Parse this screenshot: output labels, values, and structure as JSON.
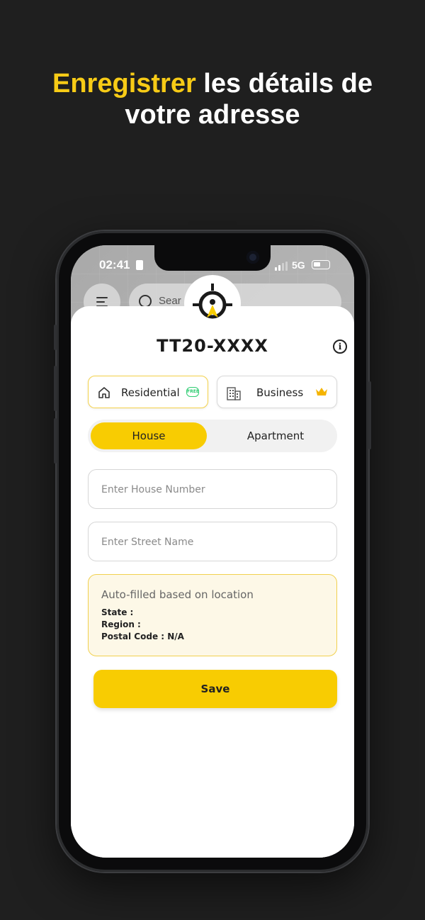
{
  "headline": {
    "accent": "Enregistrer",
    "rest_line1": " les détails de",
    "line2": "votre adresse"
  },
  "status_bar": {
    "time": "02:41",
    "network": "5G"
  },
  "map": {
    "search_placeholder": "Sear"
  },
  "sheet": {
    "plate": "TT20-XXXX",
    "info_icon": "i",
    "address_types": [
      {
        "label": "Residential",
        "badge": "FREE",
        "icon": "house-icon",
        "selected": true
      },
      {
        "label": "Business",
        "badge_icon": "crown-icon",
        "icon": "building-icon",
        "selected": false
      }
    ],
    "segments": [
      {
        "label": "House",
        "selected": true
      },
      {
        "label": "Apartment",
        "selected": false
      }
    ],
    "house_number_placeholder": "Enter House Number",
    "street_name_placeholder": "Enter Street Name",
    "auto_filled": {
      "title": "Auto-filled based on location",
      "state": "State :",
      "region": "Region :",
      "postal_code": "Postal Code : N/A"
    },
    "save_label": "Save"
  },
  "colors": {
    "accent": "#f8cc02",
    "headline_accent": "#f7cb16",
    "free_badge": "#2ecc71",
    "crown": "#f5b400",
    "background": "#1f1f1f"
  }
}
